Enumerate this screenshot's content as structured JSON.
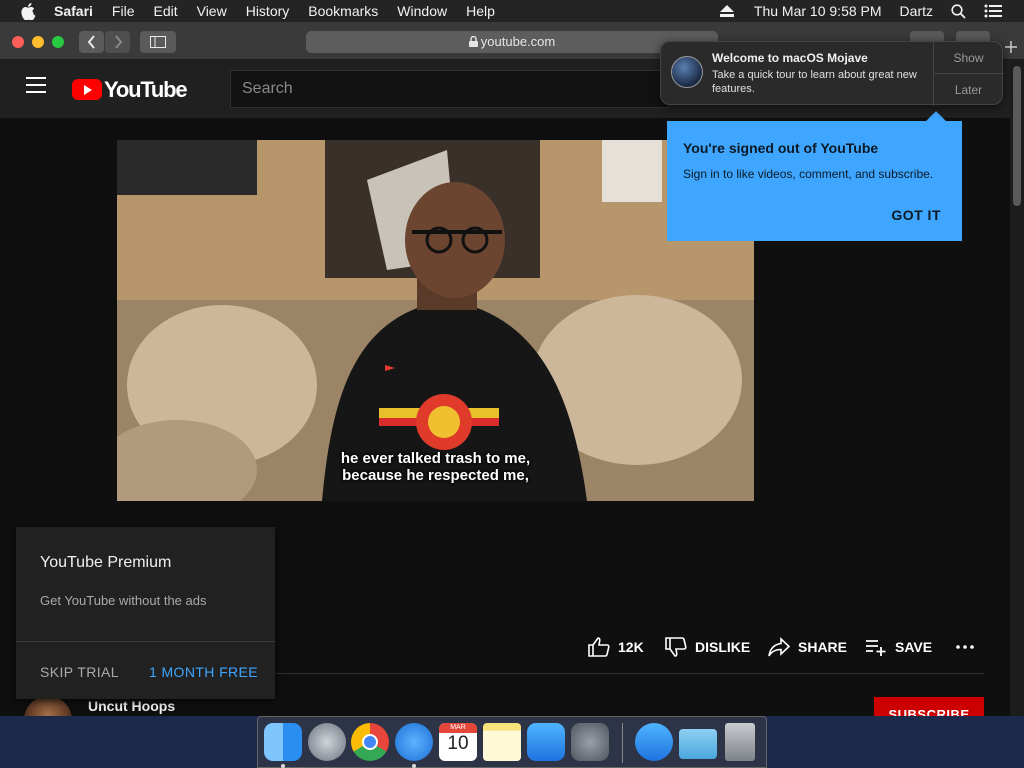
{
  "menubar": {
    "app": "Safari",
    "items": [
      "File",
      "Edit",
      "View",
      "History",
      "Bookmarks",
      "Window",
      "Help"
    ],
    "datetime": "Thu Mar 10  9:58 PM",
    "user": "Dartz"
  },
  "browser": {
    "address": "youtube.com"
  },
  "youtube": {
    "logo_text": "YouTube",
    "search_placeholder": "Search"
  },
  "notification": {
    "title": "Welcome to macOS Mojave",
    "message": "Take a quick tour to learn about great new features.",
    "show_label": "Show",
    "later_label": "Later"
  },
  "signed_out": {
    "title": "You're signed out of YouTube",
    "message": "Sign in to like videos, comment, and subscribe.",
    "button": "GOT IT"
  },
  "video": {
    "caption_line1": "he ever talked trash to me,",
    "caption_line2": "because he respected me,"
  },
  "actions": {
    "likes": "12K",
    "dislike": "DISLIKE",
    "share": "SHARE",
    "save": "SAVE"
  },
  "channel": {
    "name": "Uncut Hoops",
    "subscribe": "SUBSCRIBE"
  },
  "premium": {
    "title": "YouTube Premium",
    "subtitle": "Get YouTube without the ads",
    "skip": "SKIP TRIAL",
    "free": "1 MONTH FREE"
  },
  "dock": {
    "calendar_month": "MAR",
    "calendar_day": "10",
    "icons": [
      "finder-icon",
      "launchpad-icon",
      "chrome-icon",
      "safari-icon",
      "calendar-icon",
      "notes-icon",
      "app-store-icon",
      "system-preferences-icon",
      "app-store-folder-icon",
      "downloads-folder-icon",
      "trash-icon"
    ]
  },
  "colors": {
    "youtube_red": "#ff0000",
    "accent_blue": "#3ea6ff",
    "subscribe_red": "#cc0000",
    "background": "#0f0f0f"
  }
}
